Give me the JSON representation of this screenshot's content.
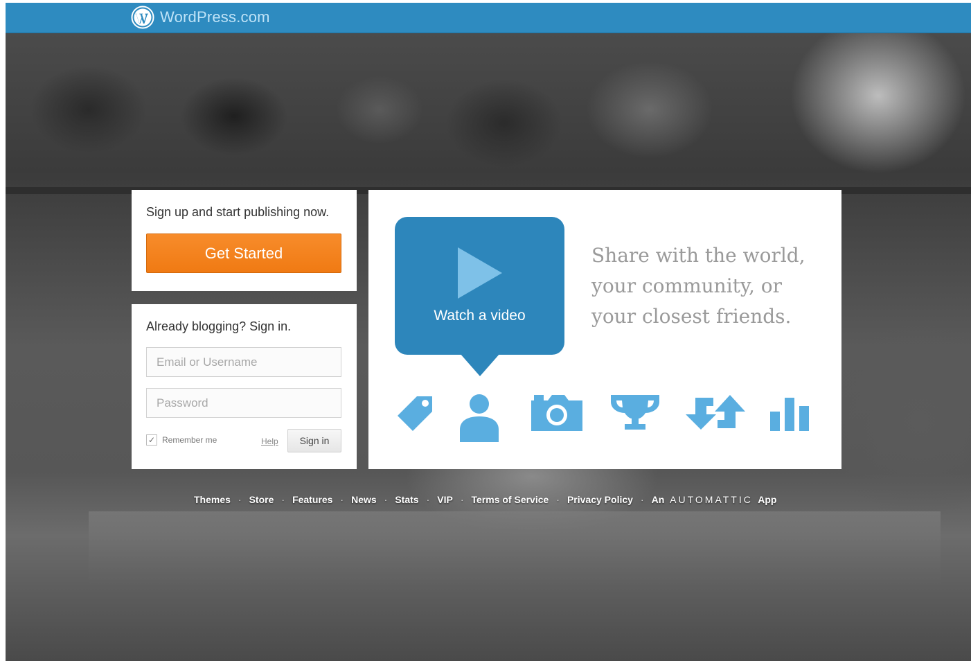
{
  "header": {
    "brand_text": "WordPress.com",
    "icon": "wordpress-logo-icon",
    "background_color": "#2e8bc0"
  },
  "signup": {
    "prompt": "Sign up and start publishing now.",
    "button_label": "Get Started",
    "button_color": "#f58220"
  },
  "signin": {
    "title": "Already blogging? Sign in.",
    "email_placeholder": "Email or Username",
    "password_placeholder": "Password",
    "remember_label": "Remember me",
    "remember_checked": true,
    "help_label": "Help",
    "button_label": "Sign in"
  },
  "video": {
    "label": "Watch a video",
    "icon": "play-icon",
    "color": "#2d86bb"
  },
  "tagline": {
    "line1": "Share with the world,",
    "line2": "your community, or",
    "line3": "your closest friends."
  },
  "feature_icons": [
    "tag-icon",
    "person-icon",
    "camera-icon",
    "trophy-icon",
    "reblog-icon",
    "stats-icon"
  ],
  "footer": {
    "links": [
      "Themes",
      "Store",
      "Features",
      "News",
      "Stats",
      "VIP",
      "Terms of Service",
      "Privacy Policy"
    ],
    "automattic_prefix": "An",
    "automattic_name": "AUTOMATTIC",
    "automattic_suffix": "App"
  }
}
